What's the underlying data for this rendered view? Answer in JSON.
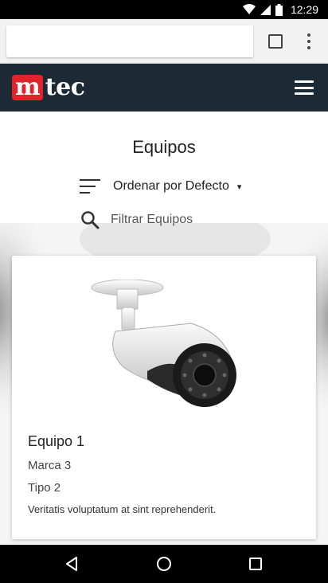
{
  "status_bar": {
    "time": "12:29",
    "icons": [
      "wifi-icon",
      "signal-icon",
      "battery-icon"
    ]
  },
  "browser": {
    "url_value": "",
    "icons": [
      "tabs-icon",
      "overflow-menu-icon"
    ]
  },
  "header": {
    "logo_mark": "m",
    "logo_rest": "tec",
    "brand_color": "#e2232a",
    "bg_color": "#1c2a36",
    "menu_icon": "hamburger-icon"
  },
  "page": {
    "title": "Equipos",
    "sort": {
      "label": "Ordenar por Defecto",
      "caret": "▾",
      "icon": "sort-icon"
    },
    "filter": {
      "label": "Filtrar Equipos",
      "icon": "search-icon"
    }
  },
  "cards": [
    {
      "title": "Equipo 1",
      "brand": "Marca 3",
      "type": "Tipo 2",
      "description": "Veritatis voluptatum at sint reprehenderit.",
      "image": "security-camera-image"
    }
  ],
  "nav_bar": {
    "icons": [
      "back-icon",
      "home-icon",
      "recents-icon"
    ]
  }
}
